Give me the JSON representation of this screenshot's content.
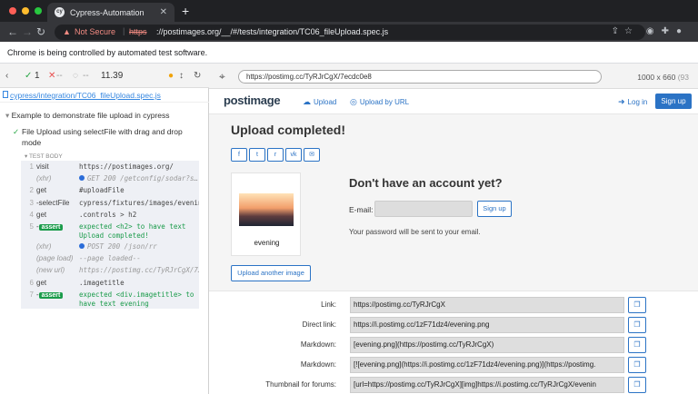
{
  "browser": {
    "tab_title": "Cypress-Automation",
    "tab_favicon": "cy",
    "new_tab": "+",
    "tab_close": "✕",
    "omnibox": {
      "security": "Not Secure",
      "scheme": "https",
      "url_rest": "://postimages.org/__/#/tests/integration/TC06_fileUpload.spec.js",
      "separator": "|"
    },
    "infobar": "Chrome is being controlled by automated test software."
  },
  "cypress": {
    "stats": {
      "passed": "1",
      "failed": "--",
      "pending": "--",
      "duration": "11.39"
    },
    "spec_path": "cypress/integration/TC06_fileUpload.spec.js",
    "suite_title": "Example to demonstrate file upload in cypress",
    "test_title": "File Upload using selectFile with drag and drop mode",
    "test_body_header": "TEST BODY",
    "commands": [
      {
        "num": "1",
        "name": "visit",
        "msg": "https://postimages.org/",
        "type": "normal"
      },
      {
        "num": "",
        "name": "(xhr)",
        "msg": "GET 200 /getconfig/sodar?s…",
        "type": "xhr"
      },
      {
        "num": "2",
        "name": "get",
        "msg": "#uploadFile",
        "type": "normal"
      },
      {
        "num": "3",
        "name": "-selectFile",
        "msg": "cypress/fixtures/images/evenin…",
        "type": "normal"
      },
      {
        "num": "4",
        "name": "get",
        "msg": ".controls > h2",
        "type": "normal"
      },
      {
        "num": "5",
        "name": "assert",
        "msg": "expected <h2> to have text Upload completed!",
        "type": "assert"
      },
      {
        "num": "",
        "name": "(xhr)",
        "msg": "POST 200 /json/rr",
        "type": "xhr"
      },
      {
        "num": "",
        "name": "(page load)",
        "msg": "--page loaded--",
        "type": "italic"
      },
      {
        "num": "",
        "name": "(new url)",
        "msg": "https://postimg.cc/TyRJrCgX/7…",
        "type": "italic"
      },
      {
        "num": "6",
        "name": "get",
        "msg": ".imagetitle",
        "type": "normal"
      },
      {
        "num": "7",
        "name": "assert",
        "msg": "expected <div.imagetitle> to have text evening",
        "type": "assert"
      }
    ]
  },
  "aut_header": {
    "url": "https://postimg.cc/TyRJrCgX/7ecdc0e8",
    "viewport": "1000 x 660",
    "scale": "(93"
  },
  "site": {
    "logo": "postimage",
    "nav": {
      "upload": "Upload",
      "upload_by_url": "Upload by URL",
      "login": "Log in",
      "signup": "Sign up"
    },
    "upload_title": "Upload completed!",
    "share_buttons": [
      "f",
      "t",
      "r",
      "vk",
      "✉"
    ],
    "thumb_caption": "evening",
    "upload_another": "Upload another image",
    "account_title": "Don't have an account yet?",
    "email_label": "E-mail:",
    "email_value": "",
    "signup_small": "Sign up",
    "password_note": "Your password will be sent to your email.",
    "links": [
      {
        "label": "Link:",
        "value": "https://postimg.cc/TyRJrCgX"
      },
      {
        "label": "Direct link:",
        "value": "https://i.postimg.cc/1zF71dz4/evening.png"
      },
      {
        "label": "Markdown:",
        "value": "[evening.png](https://postimg.cc/TyRJrCgX)"
      },
      {
        "label": "Markdown:",
        "value": "[![evening.png](https://i.postimg.cc/1zF71dz4/evening.png)](https://postimg."
      },
      {
        "label": "Thumbnail for forums:",
        "value": "[url=https://postimg.cc/TyRJrCgX][img]https://i.postimg.cc/TyRJrCgX/evenin"
      }
    ]
  },
  "colors": {
    "brand_blue": "#2b73c5",
    "pass_green": "#28a745",
    "fail_red": "#e94f4f"
  }
}
